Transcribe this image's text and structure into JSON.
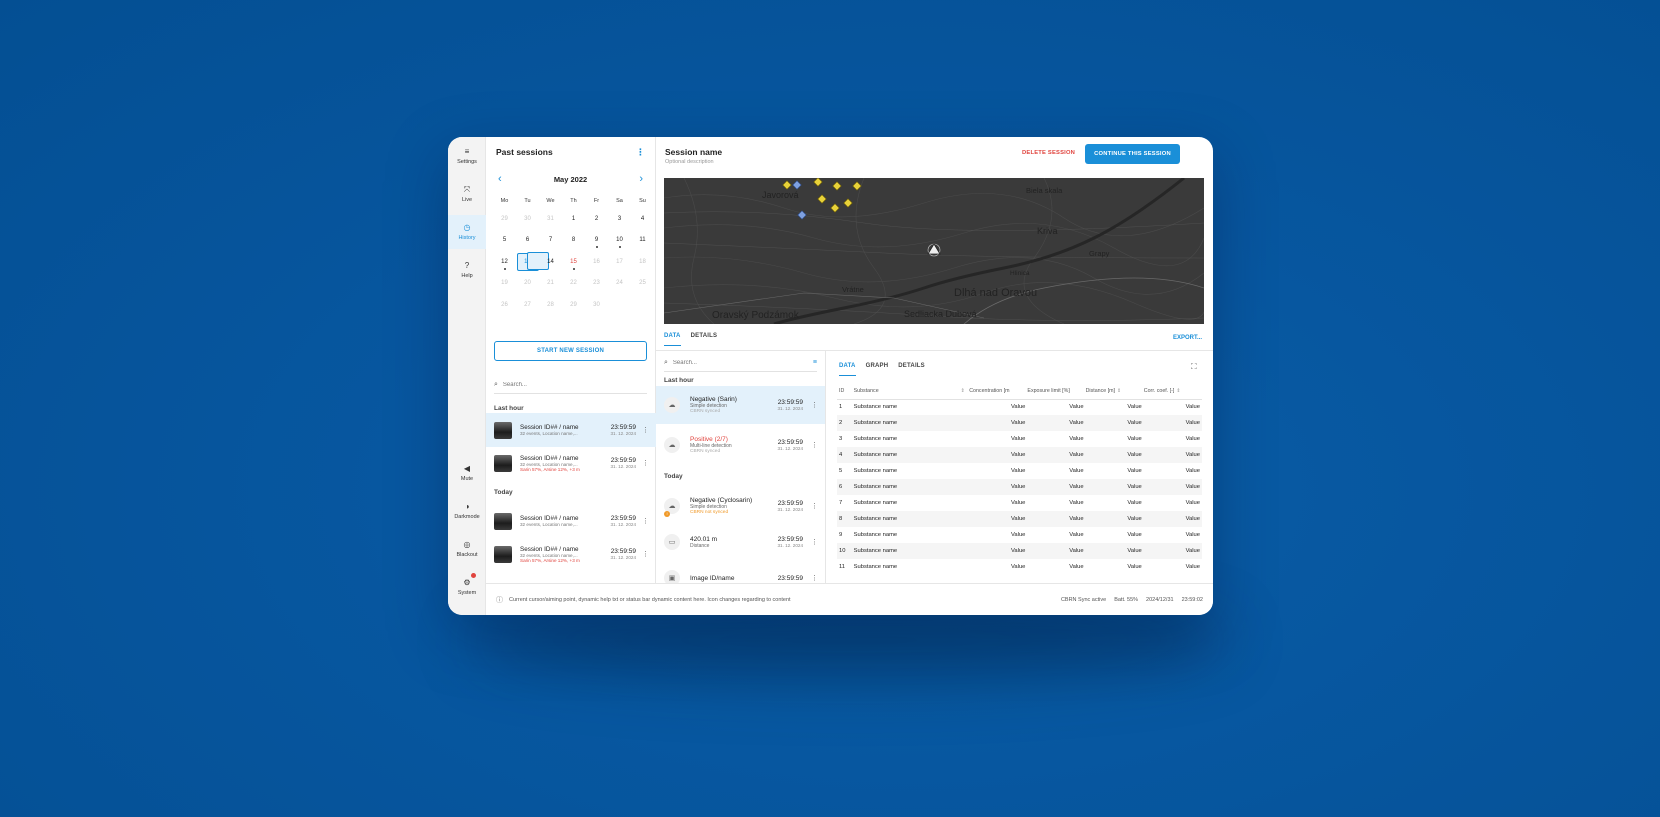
{
  "rail": {
    "top": [
      {
        "label": "Settings",
        "icon": "≡"
      },
      {
        "label": "Live",
        "icon": "⤧"
      },
      {
        "label": "History",
        "icon": "◷"
      },
      {
        "label": "Help",
        "icon": "?"
      }
    ],
    "bottom": [
      {
        "label": "Mute",
        "icon": "◀"
      },
      {
        "label": "Darkmode",
        "icon": "◑"
      },
      {
        "label": "Blackout",
        "icon": "◎"
      },
      {
        "label": "System",
        "icon": "⚙"
      }
    ]
  },
  "sessions": {
    "title": "Past sessions",
    "calendar": {
      "month": "May 2022",
      "weekdays": [
        "Mo",
        "Tu",
        "We",
        "Th",
        "Fr",
        "Sa",
        "Su"
      ],
      "days": [
        {
          "d": "29",
          "muted": true
        },
        {
          "d": "30",
          "muted": true
        },
        {
          "d": "31",
          "muted": true
        },
        {
          "d": "1"
        },
        {
          "d": "2"
        },
        {
          "d": "3"
        },
        {
          "d": "4"
        },
        {
          "d": "5"
        },
        {
          "d": "6"
        },
        {
          "d": "7"
        },
        {
          "d": "8"
        },
        {
          "d": "9",
          "dot": true
        },
        {
          "d": "10",
          "dot": true
        },
        {
          "d": "11"
        },
        {
          "d": "12",
          "dot": true
        },
        {
          "d": "13",
          "selected": true,
          "dot": true
        },
        {
          "d": "14"
        },
        {
          "d": "15",
          "red": true,
          "dot": true
        },
        {
          "d": "16",
          "muted": true
        },
        {
          "d": "17",
          "muted": true
        },
        {
          "d": "18",
          "muted": true
        },
        {
          "d": "19",
          "muted": true
        },
        {
          "d": "20",
          "muted": true
        },
        {
          "d": "21",
          "muted": true
        },
        {
          "d": "22",
          "muted": true
        },
        {
          "d": "23",
          "muted": true
        },
        {
          "d": "24",
          "muted": true
        },
        {
          "d": "25",
          "muted": true
        },
        {
          "d": "26",
          "muted": true
        },
        {
          "d": "27",
          "muted": true
        },
        {
          "d": "28",
          "muted": true
        },
        {
          "d": "29",
          "muted": true
        },
        {
          "d": "30",
          "muted": true
        },
        {
          "d": "",
          "muted": true
        },
        {
          "d": "",
          "muted": true
        }
      ]
    },
    "start_label": "START NEW SESSION",
    "search_placeholder": "Search...",
    "last_hour_label": "Last hour",
    "today_label": "Today",
    "items": [
      {
        "name": "Session ID## / name",
        "sub": "32 events, Location name,...",
        "risk": "",
        "time": "23:59:59",
        "date": "31. 12. 2024",
        "active": true
      },
      {
        "name": "Session ID## / name",
        "sub": "32 events, Location name,...",
        "risk": "Sarin 57%,  Arsine 12%, +3 m",
        "time": "23:59:59",
        "date": "31. 12. 2024"
      },
      {
        "name": "Session ID## / name",
        "sub": "32 events, Location name,...",
        "risk": "",
        "time": "23:59:59",
        "date": "31. 12. 2024"
      },
      {
        "name": "Session ID## / name",
        "sub": "32 events, Location name,...",
        "risk": "Sarin 57%,  Arsine 12%, +3 m",
        "time": "23:59:59",
        "date": "31. 12. 2024"
      }
    ]
  },
  "main": {
    "title": "Session name",
    "description": "Optional description",
    "delete_label": "DELETE SESSION",
    "continue_label": "CONTINUE THIS SESSION",
    "map_labels": [
      "Javorová",
      "Biela skala",
      "Kriva",
      "Grapy",
      "Hlinica",
      "Vrátne",
      "Dlhá nad Oravou",
      "Oravský Podzámok",
      "Sedliacka Dubová"
    ],
    "tabs": [
      "DATA",
      "DETAILS"
    ],
    "export_label": "EXPORT...",
    "events": {
      "search_placeholder": "Search...",
      "last_hour_label": "Last hour",
      "today_label": "Today",
      "items": [
        {
          "title": "Negative (Sarin)",
          "sub": "Simple detection",
          "cloud": "CBRN synced",
          "time": "23:59:59",
          "date": "31. 12. 2024",
          "icon": "☁",
          "active": true
        },
        {
          "title": "Positive (2/7)",
          "sub": "Multi-line detection",
          "cloud": "CBRN synced",
          "time": "23:59:59",
          "date": "31. 12. 2024",
          "icon": "☁",
          "red": true
        },
        {
          "title": "Negative (Cyclosarin)",
          "sub": "Simple detection",
          "cloud": "CBRN not synced",
          "time": "23:59:59",
          "date": "31. 12. 2024",
          "icon": "☁",
          "warn": true
        },
        {
          "title": "420.01 m",
          "sub": "Distance",
          "cloud": "",
          "time": "23:59:59",
          "date": "31. 12. 2024",
          "icon": "▭"
        },
        {
          "title": "Image ID/name",
          "sub": "",
          "cloud": "",
          "time": "23:59:59",
          "date": "",
          "icon": "▣"
        }
      ]
    },
    "data_panel": {
      "tabs": [
        "DATA",
        "GRAPH",
        "DETAILS"
      ],
      "columns": [
        "ID",
        "Substance",
        "Concentration [m",
        "Exposure limit [%]",
        "Distance [m]",
        "Corr. coef. [-]"
      ],
      "rows": [
        [
          "1",
          "Substance name",
          "Value",
          "Value",
          "Value",
          "Value"
        ],
        [
          "2",
          "Substance name",
          "Value",
          "Value",
          "Value",
          "Value"
        ],
        [
          "3",
          "Substance name",
          "Value",
          "Value",
          "Value",
          "Value"
        ],
        [
          "4",
          "Substance name",
          "Value",
          "Value",
          "Value",
          "Value"
        ],
        [
          "5",
          "Substance name",
          "Value",
          "Value",
          "Value",
          "Value"
        ],
        [
          "6",
          "Substance name",
          "Value",
          "Value",
          "Value",
          "Value"
        ],
        [
          "7",
          "Substance name",
          "Value",
          "Value",
          "Value",
          "Value"
        ],
        [
          "8",
          "Substance name",
          "Value",
          "Value",
          "Value",
          "Value"
        ],
        [
          "9",
          "Substance name",
          "Value",
          "Value",
          "Value",
          "Value"
        ],
        [
          "10",
          "Substance name",
          "Value",
          "Value",
          "Value",
          "Value"
        ],
        [
          "11",
          "Substance name",
          "Value",
          "Value",
          "Value",
          "Value"
        ]
      ]
    }
  },
  "status": {
    "help_text": "Current cursor/aiming point, dynamic help txt or status bar dynamic content here. Icon changes regarding to content",
    "sync": "CBRN Sync active",
    "battery": "Batt. 55%",
    "date": "2024/12/31",
    "time": "23:59:02"
  },
  "colors": {
    "accent": "#1a8fd8",
    "danger": "#e0443e",
    "warning": "#f09a2a",
    "background": "#0757a0"
  }
}
